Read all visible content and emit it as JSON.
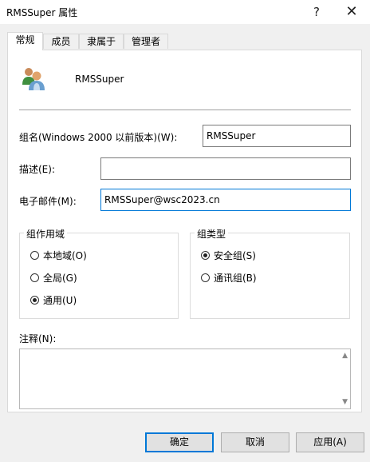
{
  "window": {
    "title": "RMSSuper 属性",
    "help_glyph": "?",
    "close_glyph": "✕"
  },
  "tabs": [
    {
      "label": "常规",
      "active": true
    },
    {
      "label": "成员",
      "active": false
    },
    {
      "label": "隶属于",
      "active": false
    },
    {
      "label": "管理者",
      "active": false
    }
  ],
  "general": {
    "group_name": "RMSSuper",
    "pre2000_label": "组名(Windows 2000 以前版本)(W):",
    "pre2000_value": "RMSSuper",
    "description_label": "描述(E):",
    "description_value": "",
    "email_label": "电子邮件(M):",
    "email_value": "RMSSuper@wsc2023.cn",
    "scope": {
      "title": "组作用域",
      "options": [
        {
          "label": "本地域(O)",
          "checked": false
        },
        {
          "label": "全局(G)",
          "checked": false
        },
        {
          "label": "通用(U)",
          "checked": true
        }
      ]
    },
    "type": {
      "title": "组类型",
      "options": [
        {
          "label": "安全组(S)",
          "checked": true
        },
        {
          "label": "通讯组(B)",
          "checked": false
        }
      ]
    },
    "notes_label": "注释(N):",
    "notes_value": ""
  },
  "buttons": {
    "ok": "确定",
    "cancel": "取消",
    "apply": "应用(A)"
  },
  "colors": {
    "focus_accent": "#0078d7",
    "panel_bg": "#ffffff",
    "window_bg": "#f0f0f0"
  }
}
